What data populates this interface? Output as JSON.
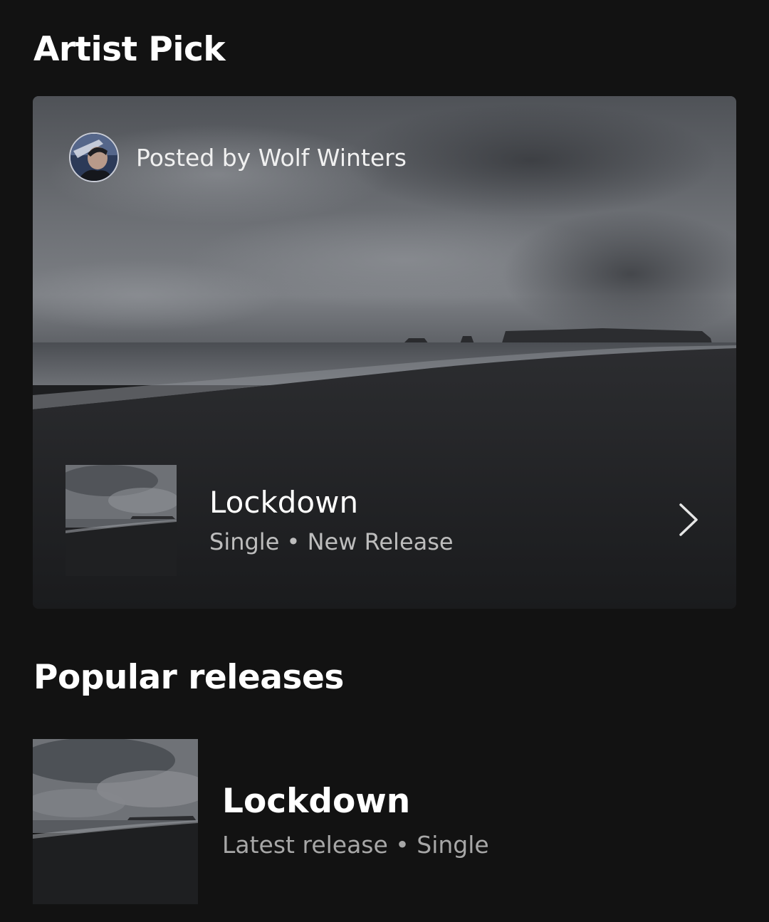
{
  "artist_pick": {
    "title": "Artist Pick",
    "posted_by": "Posted by Wolf Winters",
    "release": {
      "name": "Lockdown",
      "subtitle": "Single • New Release"
    }
  },
  "popular_releases": {
    "title": "Popular releases",
    "items": [
      {
        "name": "Lockdown",
        "subtitle": "Latest release • Single"
      }
    ]
  },
  "icons": {
    "chevron": "chevron-right-icon",
    "avatar": "artist-avatar"
  },
  "colors": {
    "background": "#121212",
    "text_primary": "#ffffff",
    "text_secondary": "#a7a7a7"
  }
}
